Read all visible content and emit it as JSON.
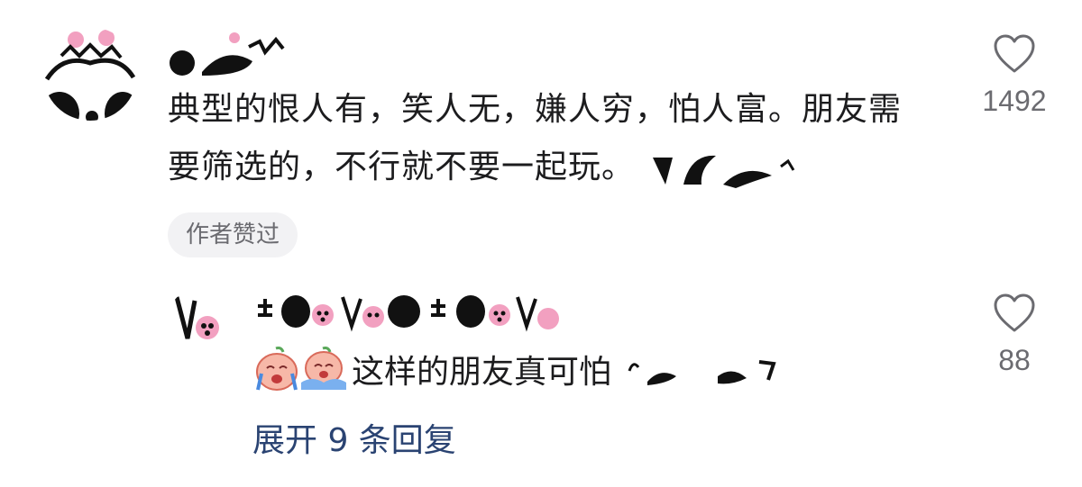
{
  "comment": {
    "text": "典型的恨人有，笑人无，嫌人穷，怕人富。朋友需要筛选的，不行就不要一起玩。",
    "author_badge": "作者赞过",
    "likes": "1492",
    "avatar_icon": "panda-avatar-icon",
    "redacted_icon": "redacted-sticker-icon"
  },
  "reply": {
    "text": "这样的朋友真可怕",
    "likes": "88",
    "avatar_icon": "panda-avatar-icon",
    "emoji_icons": [
      "crying-peach-emoji-icon",
      "crying-peach-emoji-icon"
    ]
  },
  "expand_replies": {
    "label": "展开 9 条回复"
  },
  "colors": {
    "text": "#1c1c1e",
    "secondary": "#6b6b70",
    "link": "#2a4372",
    "badge_bg": "#f2f2f4",
    "accent_pink": "#f2a0c0"
  }
}
